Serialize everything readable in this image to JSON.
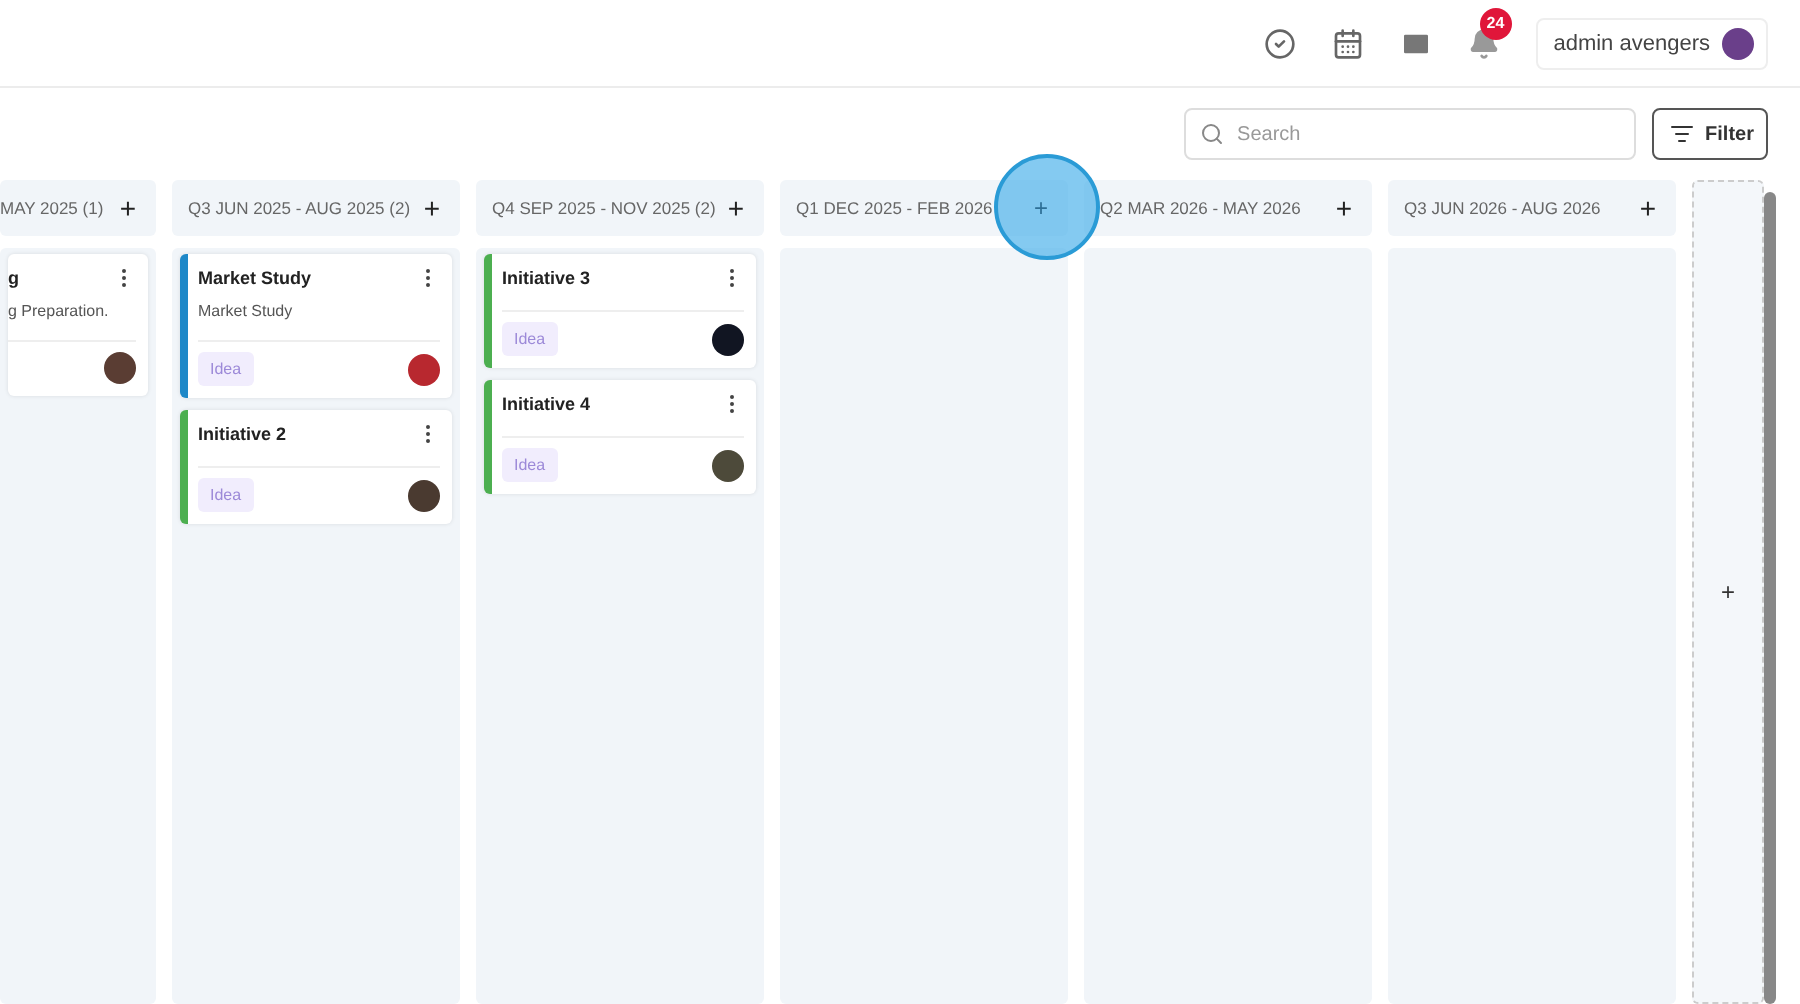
{
  "header": {
    "notification_count": "24",
    "user_name": "admin avengers"
  },
  "toolbar": {
    "search": {
      "placeholder": "Search"
    },
    "filter_label": "Filter"
  },
  "columns": [
    {
      "title": "MAY 2025 (1)",
      "add_label": "+",
      "cut": true,
      "highlighted": false,
      "cards": [
        {
          "title": "g",
          "description": "g Preparation."
        }
      ]
    },
    {
      "title": "Q3 JUN 2025 - AUG 2025 (2)",
      "add_label": "+",
      "cut": false,
      "highlighted": false,
      "cards": [
        {
          "title": "Market Study",
          "description": "Market Study",
          "tag": "Idea",
          "color": "#1e88c8"
        },
        {
          "title": "Initiative 2",
          "tag": "Idea",
          "color": "#4caf50"
        }
      ]
    },
    {
      "title": "Q4 SEP 2025 - NOV 2025 (2)",
      "add_label": "+",
      "cut": false,
      "highlighted": false,
      "cards": [
        {
          "title": "Initiative 3",
          "tag": "Idea",
          "color": "#4caf50"
        },
        {
          "title": "Initiative 4",
          "tag": "Idea",
          "color": "#4caf50"
        }
      ]
    },
    {
      "title": "Q1 DEC 2025 - FEB 2026",
      "add_label": "+",
      "cut": false,
      "highlighted": true
    },
    {
      "title": "Q2 MAR 2026 - MAY 2026",
      "add_label": "+",
      "cut": false,
      "highlighted": false
    },
    {
      "title": "Q3 JUN 2026 - AUG 2026",
      "add_label": "+",
      "cut": false,
      "highlighted": false
    }
  ],
  "add_column_label": "+"
}
